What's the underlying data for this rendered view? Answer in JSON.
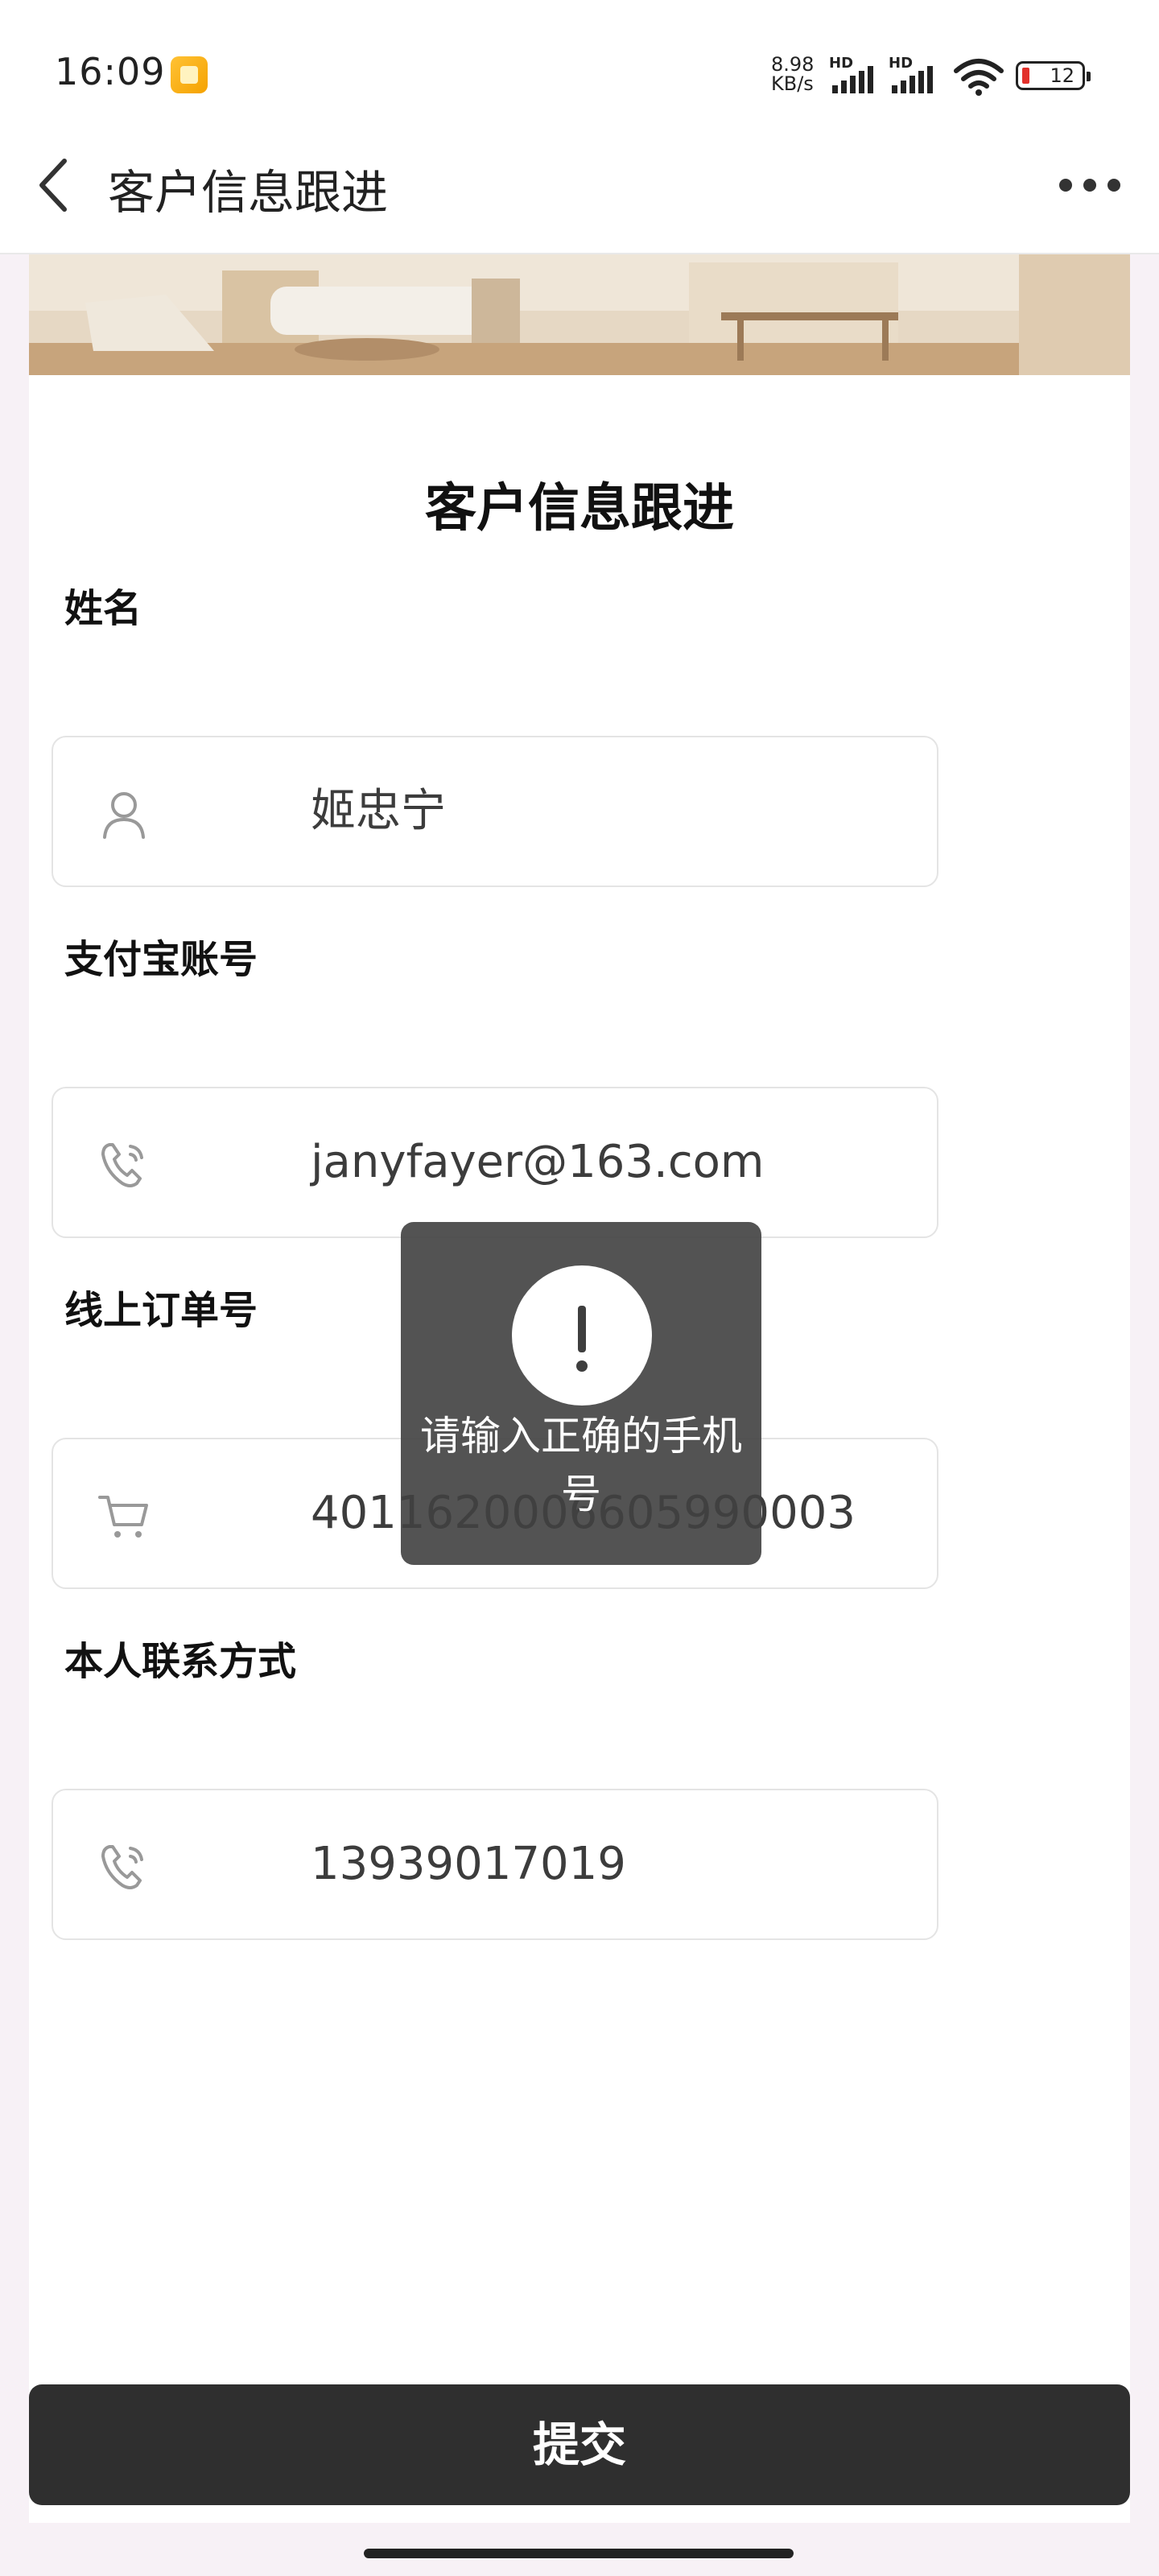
{
  "status_bar": {
    "time": "16:09",
    "net_speed": "8.98",
    "net_unit": "KB/s",
    "signal_labels": [
      "HD",
      "HD"
    ],
    "battery": "12"
  },
  "nav": {
    "title": "客户信息跟进"
  },
  "form": {
    "title": "客户信息跟进",
    "fields": [
      {
        "label": "姓名",
        "value": "姬忠宁",
        "icon": "person-icon"
      },
      {
        "label": "支付宝账号",
        "value": "janyfayer@163.com",
        "icon": "phone-icon"
      },
      {
        "label": "线上订单号",
        "value": "4011620006605990003",
        "icon": "cart-icon"
      },
      {
        "label": "本人联系方式",
        "value": "13939017019",
        "icon": "phone-icon"
      }
    ],
    "submit_label": "提交"
  },
  "toast": {
    "message": "请输入正确的手机号"
  }
}
